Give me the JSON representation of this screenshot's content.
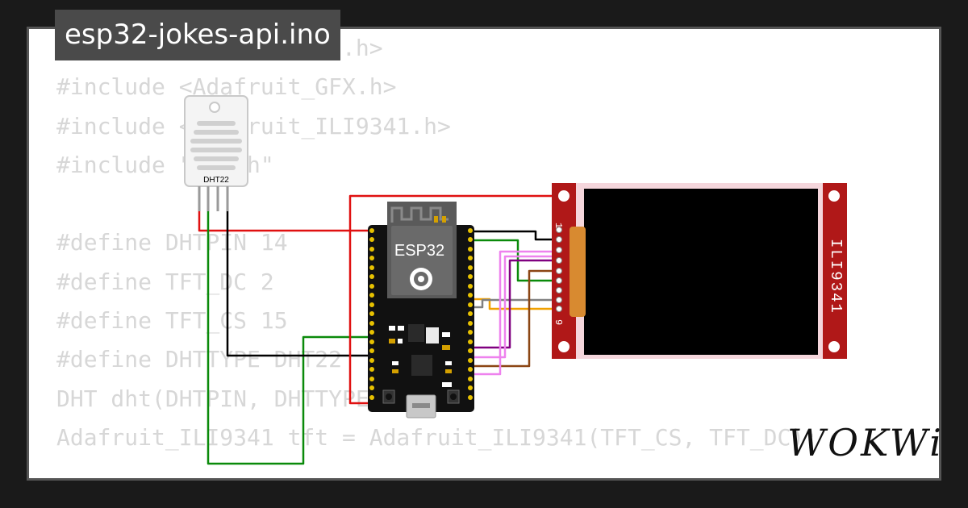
{
  "file_tab": {
    "name": "esp32-jokes-api.ino"
  },
  "code_lines": [
    "#include <ArduinoJson.h>",
    "#include <Adafruit_GFX.h>",
    "#include <Adafruit_ILI9341.h>",
    "#include \"DHT.h\"",
    "",
    "#define DHTPIN 14",
    "#define TFT_DC 2",
    "#define TFT_CS 15",
    "#define DHTTYPE DHT22",
    "DHT dht(DHTPIN, DHTTYPE);",
    "Adafruit_ILI9341 tft = Adafruit_ILI9341(TFT_CS, TFT_DC);"
  ],
  "dht_sensor": {
    "label": "DHT22"
  },
  "esp32": {
    "label": "ESP32"
  },
  "display": {
    "label": "ILI9341",
    "pin_first": "1",
    "pin_last": "9"
  },
  "brand": {
    "name": "WOKWi"
  },
  "colors": {
    "background": "#1a1a1a",
    "tab_bg": "#4a4a4a",
    "code_text": "#d7d7d7",
    "esp32_board": "#111111",
    "esp32_module": "#5a5a5a",
    "display_pcb": "#b01818",
    "display_screen": "#000000",
    "wire_red": "#e01010",
    "wire_black": "#000000",
    "wire_green": "#0a8a0a",
    "wire_pink": "#ee82ee",
    "wire_orange": "#f0a000",
    "wire_purple": "#800080",
    "wire_brown": "#8b4513",
    "wire_gray": "#808080"
  }
}
